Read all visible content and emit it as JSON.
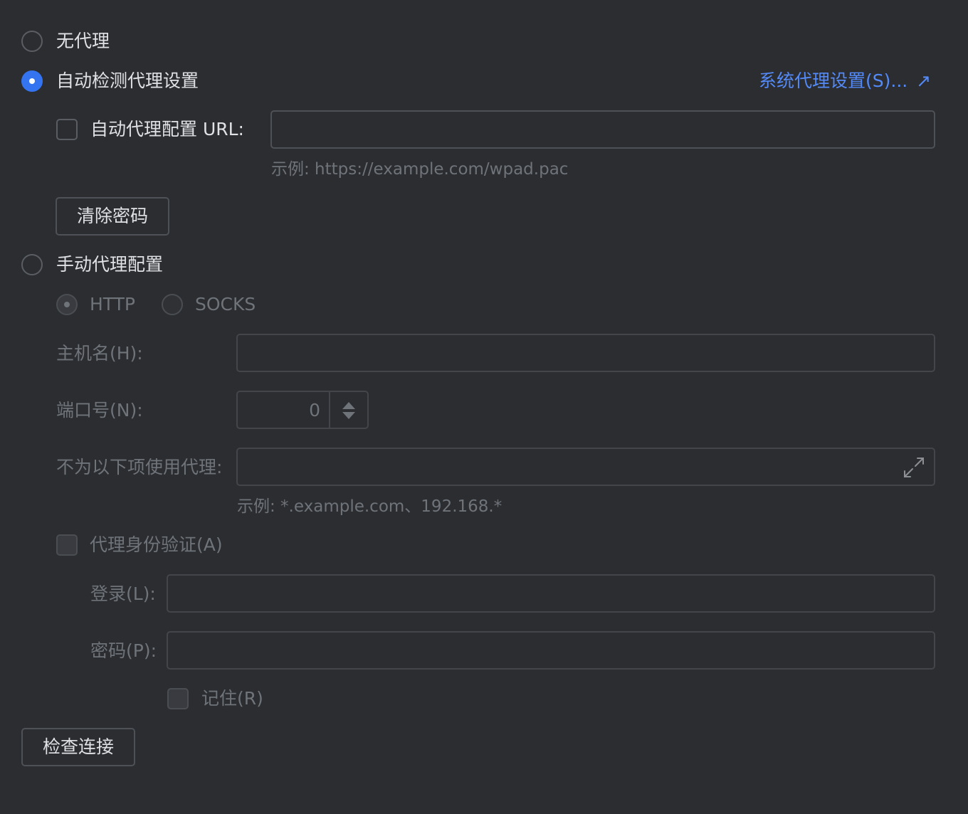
{
  "proxy": {
    "no_proxy_label": "无代理",
    "auto_detect_label": "自动检测代理设置",
    "system_settings_link": "系统代理设置(S)...",
    "system_settings_arrow": "↗",
    "pac_checkbox_label": "自动代理配置 URL:",
    "pac_url_value": "",
    "pac_example": "示例: https://example.com/wpad.pac",
    "clear_password_button": "清除密码",
    "manual_label": "手动代理配置",
    "protocol_http": "HTTP",
    "protocol_socks": "SOCKS",
    "host_label": "主机名(H):",
    "host_value": "",
    "port_label": "端口号(N):",
    "port_value": "0",
    "no_proxy_for_label": "不为以下项使用代理:",
    "no_proxy_for_value": "",
    "no_proxy_example": "示例: *.example.com、192.168.*",
    "auth_checkbox_label": "代理身份验证(A)",
    "login_label": "登录(L):",
    "login_value": "",
    "password_label": "密码(P):",
    "password_value": "",
    "remember_label": "记住(R)",
    "check_connection_button": "检查连接",
    "selected_mode": "自动检测代理设置",
    "selected_protocol": "HTTP"
  },
  "icons": {
    "expand": "expand-icon",
    "external_link": "external-link-icon"
  },
  "colors": {
    "background": "#2b2d30",
    "accent": "#3574f0",
    "link": "#548af7",
    "text": "#dfe1e5",
    "disabled_text": "#6f737a"
  }
}
